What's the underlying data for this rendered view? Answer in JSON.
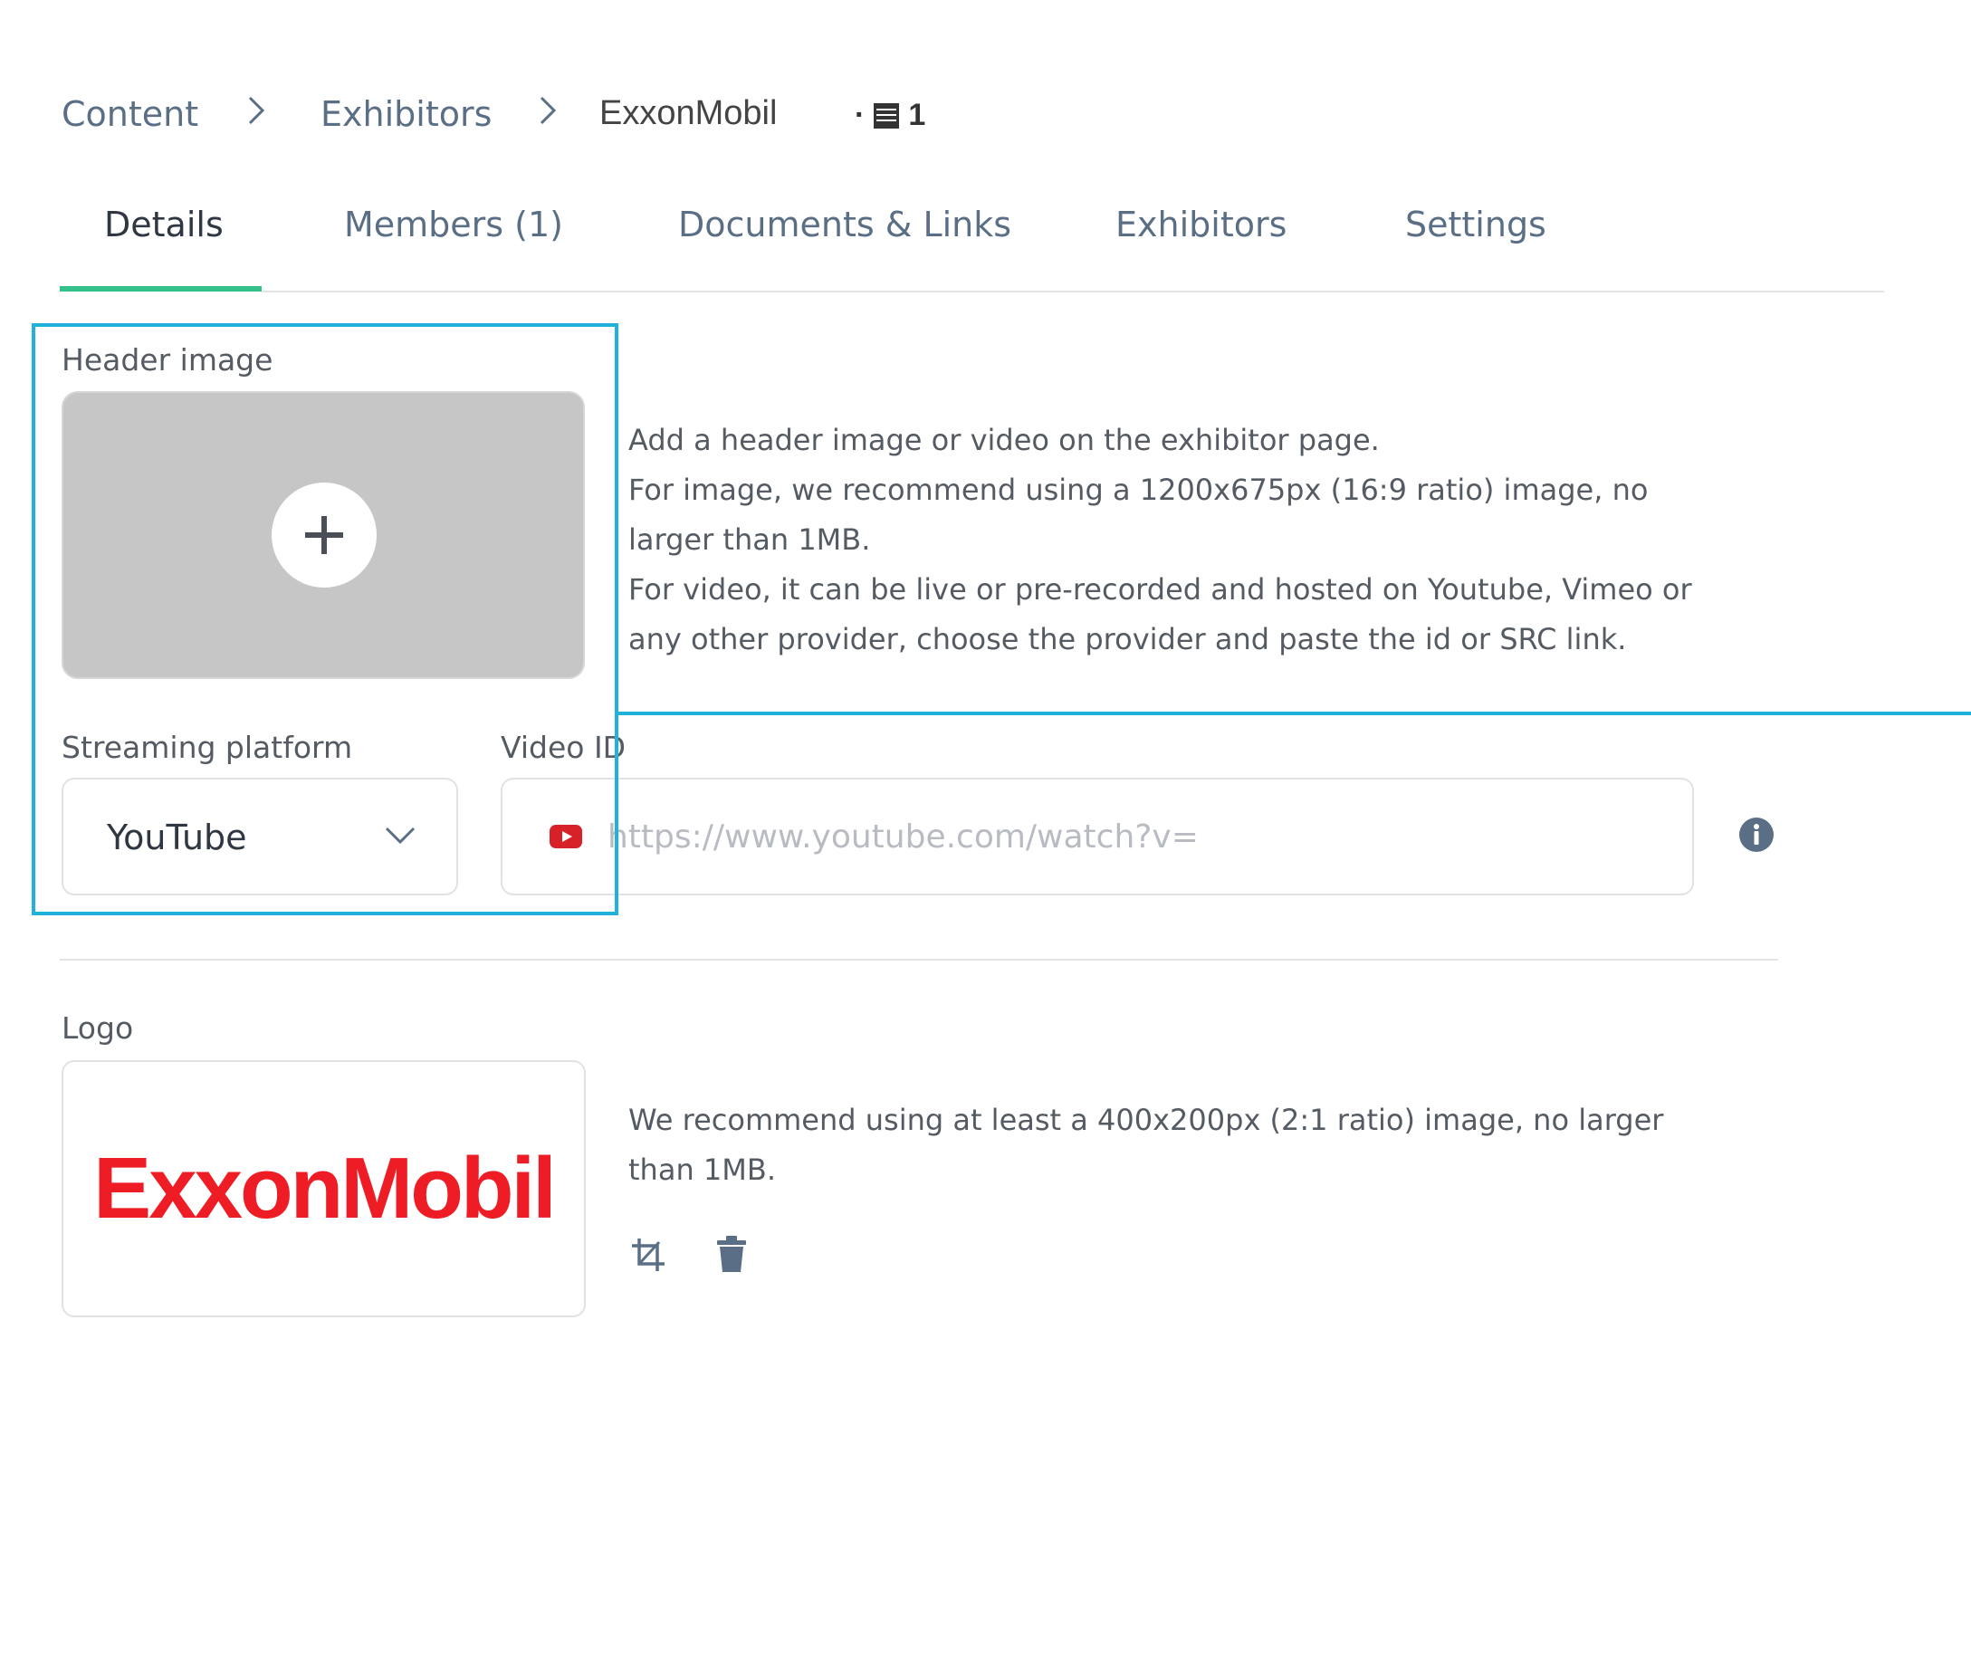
{
  "breadcrumb": {
    "items": [
      "Content",
      "Exhibitors"
    ],
    "current": "ExxonMobil",
    "count": "1",
    "count_icon": "list-document-icon"
  },
  "tabs": [
    {
      "label": "Details",
      "active": true
    },
    {
      "label": "Members (1)",
      "active": false
    },
    {
      "label": "Documents & Links",
      "active": false
    },
    {
      "label": "Exhibitors",
      "active": false
    },
    {
      "label": "Settings",
      "active": false
    }
  ],
  "header_image": {
    "label": "Header image",
    "add_icon": "plus-icon",
    "description": [
      "Add a header image or video on the exhibitor page.",
      "For image, we recommend using a 1200x675px (16:9 ratio) image, no",
      "larger than 1MB.",
      "For video, it can be live or pre-recorded and hosted on Youtube, Vimeo or",
      "any other provider, choose the provider and paste the id or SRC link."
    ]
  },
  "streaming": {
    "label": "Streaming platform",
    "selected": "YouTube"
  },
  "video": {
    "label": "Video ID",
    "value": "",
    "placeholder": "https://www.youtube.com/watch?v=",
    "provider_icon": "youtube-icon",
    "help_icon": "info-icon"
  },
  "logo": {
    "label": "Logo",
    "brand_text": "ExxonMobil",
    "description": [
      "We recommend using at least a 400x200px (2:1 ratio) image, no larger",
      "than 1MB."
    ],
    "actions": [
      "crop-icon",
      "trash-icon"
    ]
  },
  "colors": {
    "accent_tab": "#35c08a",
    "highlight": "#20b1dc",
    "brand_red": "#ee1c25",
    "youtube_red": "#d62128"
  }
}
